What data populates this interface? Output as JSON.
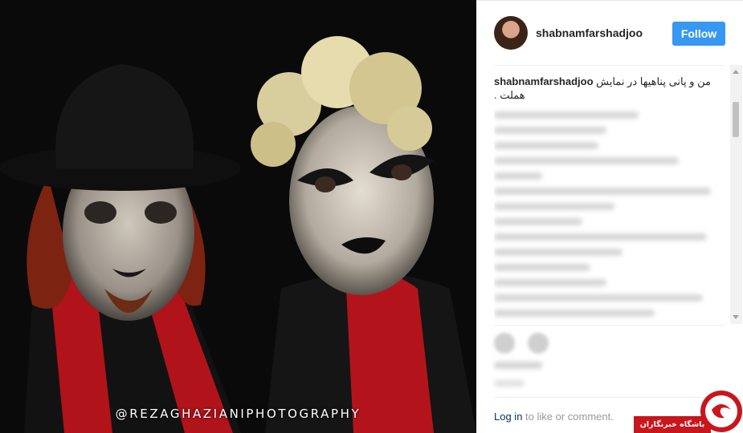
{
  "photo": {
    "watermark": "@REZAGHAZIANIPHOTOGRAPHY",
    "background_color": "#0a0a0a"
  },
  "post": {
    "username": "shabnamfarshadjoo",
    "follow_label": "Follow",
    "caption_user": "shabnamfarshadjoo",
    "caption_text": "من و پانی پناهیها در نمایش هملت .",
    "login_link": "Log in",
    "login_text": " to like or comment."
  },
  "badge": {
    "label": "باشگاه خبرنگاران",
    "logo_letter": "ج"
  },
  "colors": {
    "follow_button": "#3897f0",
    "login_link": "#003569",
    "badge_red": "#c8161d"
  }
}
